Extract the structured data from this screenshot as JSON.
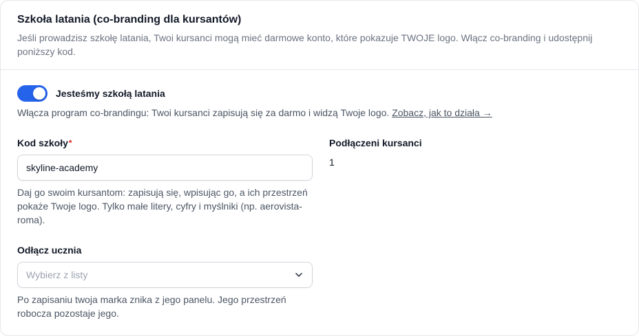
{
  "section": {
    "title": "Szkoła latania (co-branding dla kursantów)",
    "description": "Jeśli prowadzisz szkołę latania, Twoi kursanci mogą mieć darmowe konto, które pokazuje TWOJE logo. Włącz co-branding i udostępnij poniższy kod."
  },
  "toggle": {
    "label": "Jesteśmy szkołą latania",
    "enabled": true,
    "help_text": "Włącza program co-brandingu: Twoi kursanci zapisują się za darmo i widzą Twoje logo.",
    "help_link": "Zobacz, jak to działa →"
  },
  "school_code": {
    "label": "Kod szkoły",
    "required_mark": "*",
    "value": "skyline-academy",
    "help": "Daj go swoim kursantom: zapisują się, wpisując go, a ich przestrzeń pokaże Twoje logo. Tylko małe litery, cyfry i myślniki (np. aerovista-roma)."
  },
  "connected_students": {
    "label": "Podłączeni kursanci",
    "count": "1"
  },
  "disconnect_student": {
    "label": "Odłącz ucznia",
    "placeholder": "Wybierz z listy",
    "help": "Po zapisaniu twoja marka znika z jego panelu. Jego przestrzeń robocza pozostaje jego."
  },
  "colors": {
    "accent": "#2563eb",
    "required": "#dc2626"
  }
}
